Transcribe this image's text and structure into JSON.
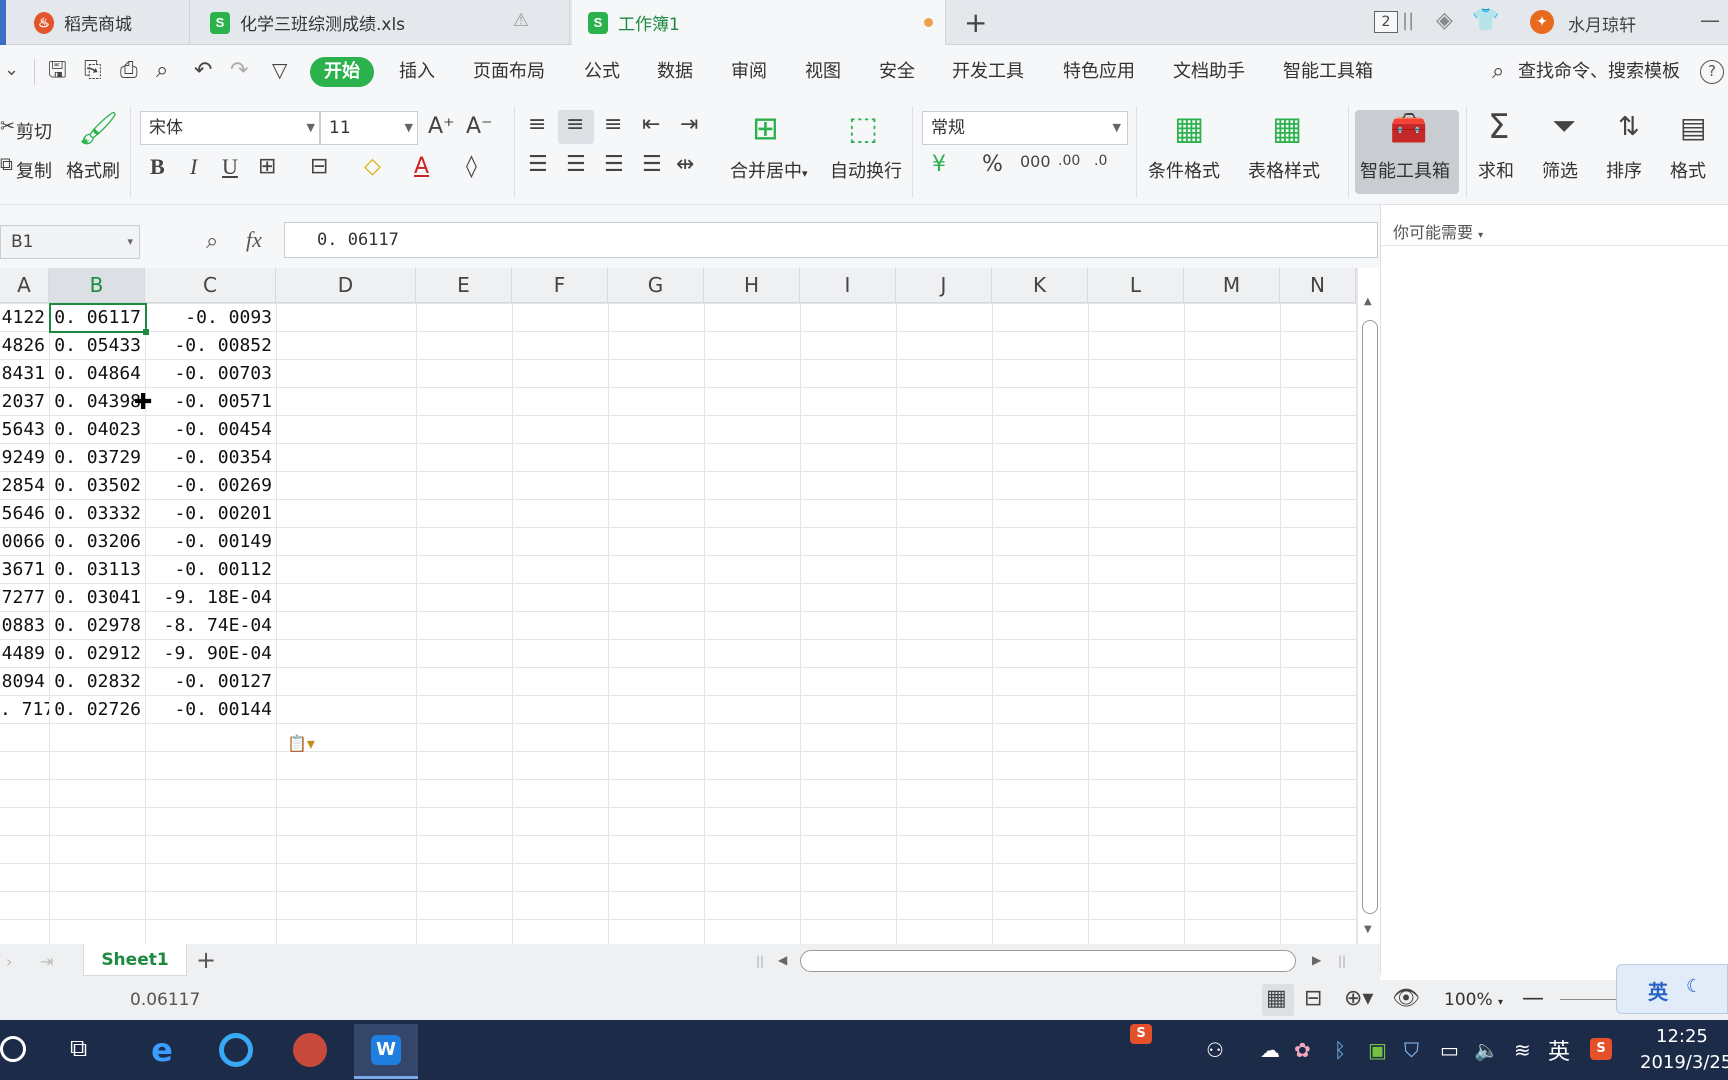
{
  "tabs": [
    {
      "label": "稻壳商城",
      "icon": "daoke-flame-icon"
    },
    {
      "label": "化学三班综测成绩.xls",
      "icon": "et-sheet-icon",
      "warning_icon": "warning-triangle-icon"
    },
    {
      "label": "工作簿1",
      "icon": "et-sheet-icon"
    }
  ],
  "tabbar": {
    "new_tab_symbol": "+",
    "window_count": "2",
    "user_name": "水月琼轩"
  },
  "menu": {
    "items": [
      "开始",
      "插入",
      "页面布局",
      "公式",
      "数据",
      "审阅",
      "视图",
      "安全",
      "开发工具",
      "特色应用",
      "文档助手",
      "智能工具箱"
    ],
    "active": "开始",
    "search_label": "查找命令、搜索模板",
    "help_symbol": "?"
  },
  "ribbon": {
    "cut": "剪切",
    "copy": "复制",
    "format_painter": "格式刷",
    "font_name": "宋体",
    "font_size": "11",
    "bold": "B",
    "italic": "I",
    "underline": "U",
    "merge_center": "合并居中",
    "wrap_text": "自动换行",
    "number_format": "常规",
    "conditional_format": "条件格式",
    "table_style": "表格样式",
    "smart_toolbox": "智能工具箱",
    "sum": "求和",
    "filter": "筛选",
    "sort": "排序",
    "format": "格式"
  },
  "formula": {
    "name_box": "B1",
    "fx": "fx",
    "value": "0. 06117"
  },
  "right_panel": {
    "title": "你可能需要"
  },
  "columns": [
    "A",
    "B",
    "C",
    "D",
    "E",
    "F",
    "G",
    "H",
    "I",
    "J",
    "K",
    "L",
    "M",
    "N"
  ],
  "selected_column": "B",
  "rows": [
    {
      "a": "4122",
      "b": "0. 06117",
      "c": "-0. 0093"
    },
    {
      "a": "4826",
      "b": "0. 05433",
      "c": "-0. 00852"
    },
    {
      "a": "8431",
      "b": "0. 04864",
      "c": "-0. 00703"
    },
    {
      "a": "2037",
      "b": "0. 04398",
      "c": "-0. 00571"
    },
    {
      "a": "5643",
      "b": "0. 04023",
      "c": "-0. 00454"
    },
    {
      "a": "9249",
      "b": "0. 03729",
      "c": "-0. 00354"
    },
    {
      "a": "2854",
      "b": "0. 03502",
      "c": "-0. 00269"
    },
    {
      "a": "5646",
      "b": "0. 03332",
      "c": "-0. 00201"
    },
    {
      "a": "0066",
      "b": "0. 03206",
      "c": "-0. 00149"
    },
    {
      "a": "3671",
      "b": "0. 03113",
      "c": "-0. 00112"
    },
    {
      "a": "7277",
      "b": "0. 03041",
      "c": "-9. 18E-04"
    },
    {
      "a": "0883",
      "b": "0. 02978",
      "c": "-8. 74E-04"
    },
    {
      "a": "4489",
      "b": "0. 02912",
      "c": "-9. 90E-04"
    },
    {
      "a": "8094",
      "b": "0. 02832",
      "c": "-0. 00127"
    },
    {
      "a": ". 717",
      "b": "0. 02726",
      "c": "-0. 00144"
    }
  ],
  "sheet": {
    "name": "Sheet1",
    "add_symbol": "+"
  },
  "status": {
    "cell_value": "0.06117",
    "zoom": "100%",
    "ime_mode": "英"
  },
  "taskbar": {
    "ime": "英",
    "time": "12:25",
    "date": "2019/3/25"
  },
  "colors": {
    "brand_green": "#2bb24c",
    "selection_green": "#1e8a3f",
    "taskbar": "#1c2b47"
  }
}
